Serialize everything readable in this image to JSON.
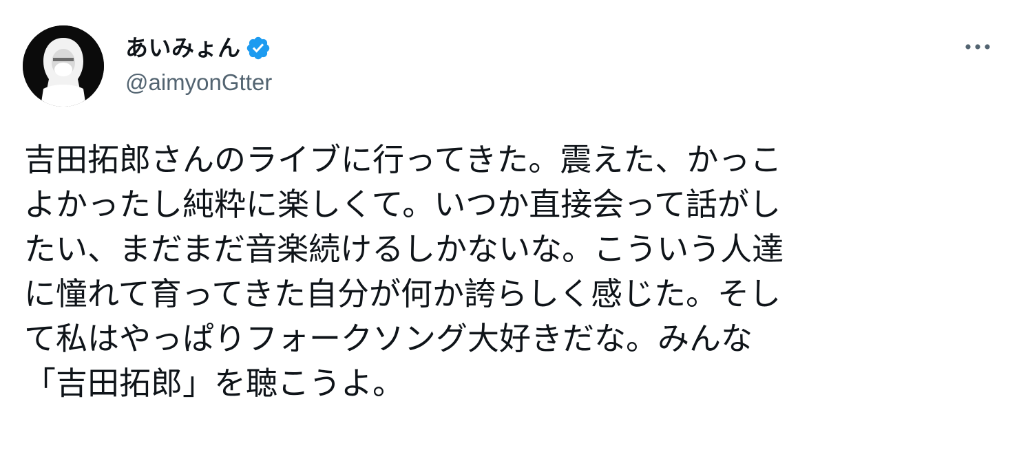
{
  "author": {
    "display_name": "あいみょん",
    "handle": "@aimyonGtter",
    "verified": true,
    "verified_badge_color": "#1d9bf0",
    "avatar_icon": "profile-photo-white-hood"
  },
  "menu": {
    "more_icon": "more-horizontal-icon"
  },
  "tweet": {
    "lines": [
      "吉田拓郎さんのライブに行ってきた。震えた、かっこ",
      "よかったし純粋に楽しくて。いつか直接会って話がし",
      "たい、まだまだ音楽続けるしかないな。こういう人達",
      "に憧れて育ってきた自分が何か誇らしく感じた。そし",
      "て私はやっぱりフォークソング大好きだな。みんな",
      "「吉田拓郎」を聴こうよ。"
    ]
  },
  "colors": {
    "text_primary": "#0f1419",
    "text_secondary": "#536471",
    "background": "#ffffff"
  }
}
